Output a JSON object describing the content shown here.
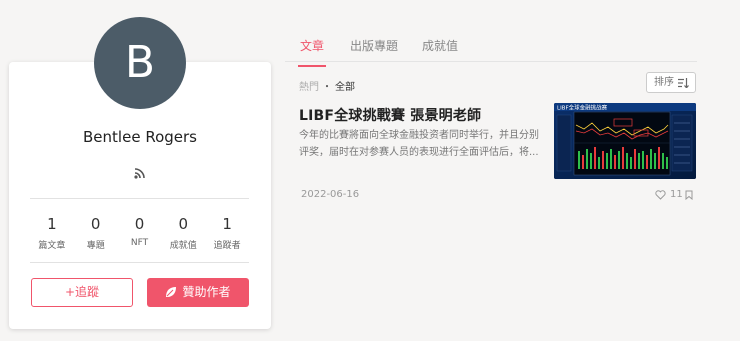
{
  "profile": {
    "avatar_letter": "B",
    "name": "Bentlee Rogers",
    "stats": [
      {
        "value": "1",
        "label": "篇文章"
      },
      {
        "value": "0",
        "label": "專題"
      },
      {
        "value": "0",
        "label": "NFT"
      },
      {
        "value": "0",
        "label": "成就值"
      },
      {
        "value": "1",
        "label": "追蹤者"
      }
    ],
    "follow_label": "+追蹤",
    "sponsor_label": "贊助作者"
  },
  "tabs": [
    "文章",
    "出版專題",
    "成就值"
  ],
  "filter": {
    "hot": "熱門",
    "dot": "・",
    "all": "全部"
  },
  "sort_label": "排序",
  "article": {
    "title": "LIBF全球挑戰賽 張景明老師",
    "excerpt": "今年的比賽將面向全球金融投资者同时举行，并且分别评奖，届时在对参赛人员的表现进行全面评估后，将...",
    "date": "2022-06-16",
    "likes": "11",
    "thumbnail_caption": "LIBF全球金融挑战赛"
  },
  "colors": {
    "accent": "#f0556b",
    "avatar_bg": "#4c5c68"
  }
}
